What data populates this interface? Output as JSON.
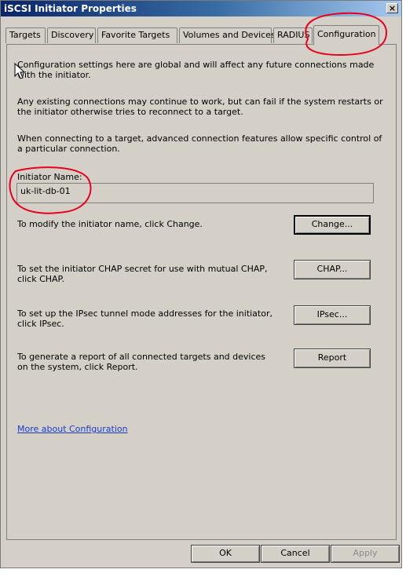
{
  "window": {
    "title": "iSCSI Initiator Properties",
    "close_label": "×"
  },
  "tabs": [
    {
      "label": "Targets"
    },
    {
      "label": "Discovery"
    },
    {
      "label": "Favorite Targets"
    },
    {
      "label": "Volumes and Devices"
    },
    {
      "label": "RADIUS"
    },
    {
      "label": "Configuration",
      "active": true
    }
  ],
  "panel": {
    "intro_text": "Configuration settings here are global and will affect any future connections made with the initiator.",
    "existing_text": "Any existing connections may continue to work, but can fail if the system restarts or the initiator otherwise tries to reconnect to a target.",
    "advanced_text": "When connecting to a target, advanced connection features allow specific control of a particular connection.",
    "initiator_name_label": "Initiator Name:",
    "initiator_name_value": "uk-lit-db-01",
    "modify_text": "To modify the initiator name, click Change.",
    "change_label": "Change...",
    "chap_text": "To set the initiator CHAP secret for use with mutual CHAP, click CHAP.",
    "chap_label": "CHAP...",
    "ipsec_text": "To set up the IPsec tunnel mode addresses for the initiator, click IPsec.",
    "ipsec_label": "IPsec...",
    "report_text": "To generate a report of all connected targets and devices on the system, click Report.",
    "report_label": "Report",
    "more_link": "More about Configuration"
  },
  "footer": {
    "ok_label": "OK",
    "cancel_label": "Cancel",
    "apply_label": "Apply"
  },
  "colors": {
    "annotation": "#e8001c",
    "link": "#1a3ccc",
    "dialog_bg": "#d4d0c8"
  },
  "icons": [
    "close-icon",
    "mouse-pointer-icon"
  ]
}
